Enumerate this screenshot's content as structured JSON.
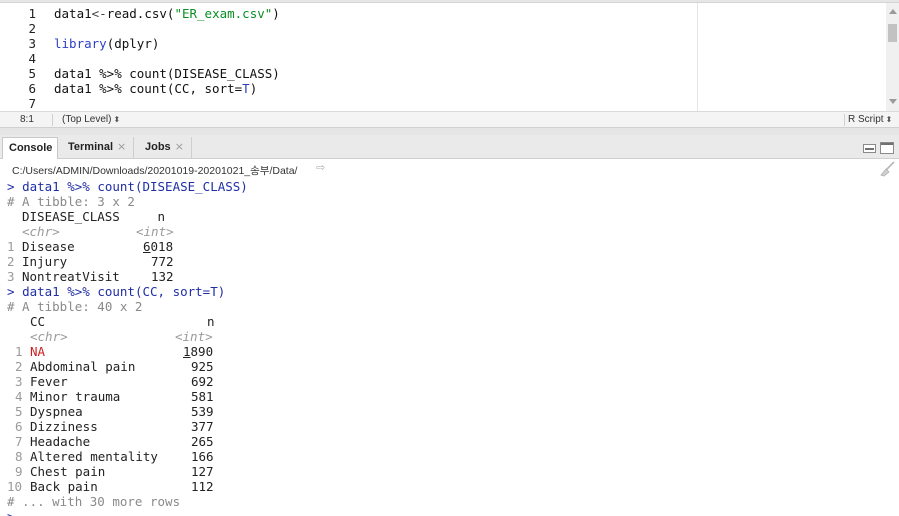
{
  "editor": {
    "line_numbers": [
      "1",
      "2",
      "3",
      "4",
      "5",
      "6",
      "7"
    ],
    "line1": {
      "var": "data1",
      "op": "<-",
      "fn": "read.csv(",
      "str": "\"ER_exam.csv\"",
      "close": ")"
    },
    "line3": {
      "fn": "library",
      "rest": "(dplyr)"
    },
    "line5": {
      "text": "data1 %>% count(DISEASE_CLASS)"
    },
    "line6": {
      "pre": "data1 %>% count(CC, sort=",
      "val": "T",
      "close": ")"
    }
  },
  "status_bar": {
    "cursor_position": "8:1",
    "scope": "(Top Level)",
    "file_type": "R Script"
  },
  "console_tabs": {
    "console": "Console",
    "terminal": "Terminal",
    "jobs": "Jobs",
    "close_glyph": "×"
  },
  "console_path": "C:/Users/ADMIN/Downloads/20201019-20201021_송부/Data/",
  "console": {
    "prompt": ">",
    "cmd1": "data1 %>% count(DISEASE_CLASS)",
    "tibble1_header": "# A tibble: 3 x 2",
    "t1_colnames": "DISEASE_CLASS     n",
    "t1_types": {
      "chr": "<chr>",
      "int": "<int>"
    },
    "t1_rows": [
      {
        "idx": "1",
        "name": "Disease",
        "n_lead": "6",
        "n_rest": "018"
      },
      {
        "idx": "2",
        "name": "Injury",
        "n": "772"
      },
      {
        "idx": "3",
        "name": "NontreatVisit",
        "n": "132"
      }
    ],
    "cmd2": "data1 %>% count(CC, sort=T)",
    "tibble2_header": "# A tibble: 40 x 2",
    "t2_colnames": {
      "cc": "CC",
      "n": "n"
    },
    "t2_types": {
      "chr": "<chr>",
      "int": "<int>"
    },
    "t2_rows": [
      {
        "idx": "1",
        "name": "NA",
        "n_lead": "1",
        "n_rest": "890"
      },
      {
        "idx": "2",
        "name": "Abdominal pain",
        "n": "925"
      },
      {
        "idx": "3",
        "name": "Fever",
        "n": "692"
      },
      {
        "idx": "4",
        "name": "Minor trauma",
        "n": "581"
      },
      {
        "idx": "5",
        "name": "Dyspnea",
        "n": "539"
      },
      {
        "idx": "6",
        "name": "Dizziness",
        "n": "377"
      },
      {
        "idx": "7",
        "name": "Headache",
        "n": "265"
      },
      {
        "idx": "8",
        "name": "Altered mentality",
        "n": "166"
      },
      {
        "idx": "9",
        "name": "Chest pain",
        "n": "127"
      },
      {
        "idx": "10",
        "name": "Back pain",
        "n": "112"
      }
    ],
    "more_rows": "# ... with 30 more rows"
  },
  "colors": {
    "keyword_blue": "#2f3fc4",
    "string_green": "#0a8f25",
    "na_red": "#c91f1f",
    "comment_gray": "#8a8a8a"
  }
}
